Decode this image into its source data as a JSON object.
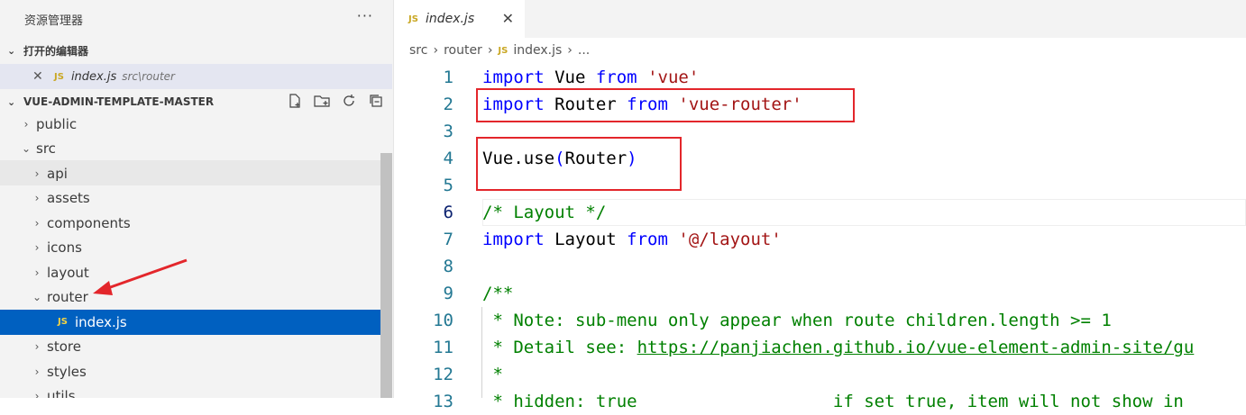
{
  "sidebar": {
    "title": "资源管理器",
    "more": "···",
    "open_editors": {
      "label": "打开的编辑器",
      "items": [
        {
          "badge": "JS",
          "name": "index.js",
          "path": "src\\router",
          "close": "✕"
        }
      ]
    },
    "project": {
      "label": "VUE-ADMIN-TEMPLATE-MASTER",
      "tools": [
        "new-file-icon",
        "new-folder-icon",
        "refresh-icon",
        "collapse-all-icon"
      ]
    },
    "tree": [
      {
        "label": "public",
        "arrow": "›",
        "indent": 0
      },
      {
        "label": "src",
        "arrow": "⌄",
        "indent": 0
      },
      {
        "label": "api",
        "arrow": "›",
        "indent": 1
      },
      {
        "label": "assets",
        "arrow": "›",
        "indent": 1
      },
      {
        "label": "components",
        "arrow": "›",
        "indent": 1
      },
      {
        "label": "icons",
        "arrow": "›",
        "indent": 1
      },
      {
        "label": "layout",
        "arrow": "›",
        "indent": 1
      },
      {
        "label": "router",
        "arrow": "⌄",
        "indent": 1
      },
      {
        "label": "index.js",
        "badge": "JS",
        "indent": 2,
        "selected": true
      },
      {
        "label": "store",
        "arrow": "›",
        "indent": 1
      },
      {
        "label": "styles",
        "arrow": "›",
        "indent": 1
      },
      {
        "label": "utils",
        "arrow": "›",
        "indent": 1
      }
    ]
  },
  "editor": {
    "tab": {
      "badge": "JS",
      "name": "index.js",
      "close": "✕"
    },
    "breadcrumb": [
      "src",
      "›",
      "router",
      "›",
      "JS",
      "index.js",
      "›",
      "..."
    ],
    "lines": [
      {
        "n": "1",
        "tokens": [
          [
            "kw",
            "import"
          ],
          [
            "plain",
            " Vue "
          ],
          [
            "kw",
            "from"
          ],
          [
            "plain",
            " "
          ],
          [
            "str",
            "'vue'"
          ]
        ]
      },
      {
        "n": "2",
        "tokens": [
          [
            "kw",
            "import"
          ],
          [
            "plain",
            " Router "
          ],
          [
            "kw",
            "from"
          ],
          [
            "plain",
            " "
          ],
          [
            "str",
            "'vue-router'"
          ]
        ]
      },
      {
        "n": "3",
        "tokens": []
      },
      {
        "n": "4",
        "tokens": [
          [
            "plain",
            "Vue.use"
          ],
          [
            "kw",
            "("
          ],
          [
            "plain",
            "Router"
          ],
          [
            "kw",
            ")"
          ]
        ]
      },
      {
        "n": "5",
        "tokens": []
      },
      {
        "n": "6",
        "active": true,
        "tokens": [
          [
            "cmt",
            "/* Layout */"
          ]
        ]
      },
      {
        "n": "7",
        "tokens": [
          [
            "kw",
            "import"
          ],
          [
            "plain",
            " Layout "
          ],
          [
            "kw",
            "from"
          ],
          [
            "plain",
            " "
          ],
          [
            "str",
            "'@/layout'"
          ]
        ]
      },
      {
        "n": "8",
        "tokens": []
      },
      {
        "n": "9",
        "tokens": [
          [
            "cmt",
            "/**"
          ]
        ]
      },
      {
        "n": "10",
        "tokens": [
          [
            "cmt",
            " * Note: sub-menu only appear when route children.length >= 1"
          ]
        ]
      },
      {
        "n": "11",
        "tokens": [
          [
            "cmt",
            " * Detail see: "
          ],
          [
            "link",
            "https://panjiachen.github.io/vue-element-admin-site/gu"
          ]
        ]
      },
      {
        "n": "12",
        "tokens": [
          [
            "cmt",
            " *"
          ]
        ]
      },
      {
        "n": "13",
        "tokens": [
          [
            "cmt",
            " * hidden: true                   if set true, item will not show in"
          ]
        ]
      }
    ]
  }
}
